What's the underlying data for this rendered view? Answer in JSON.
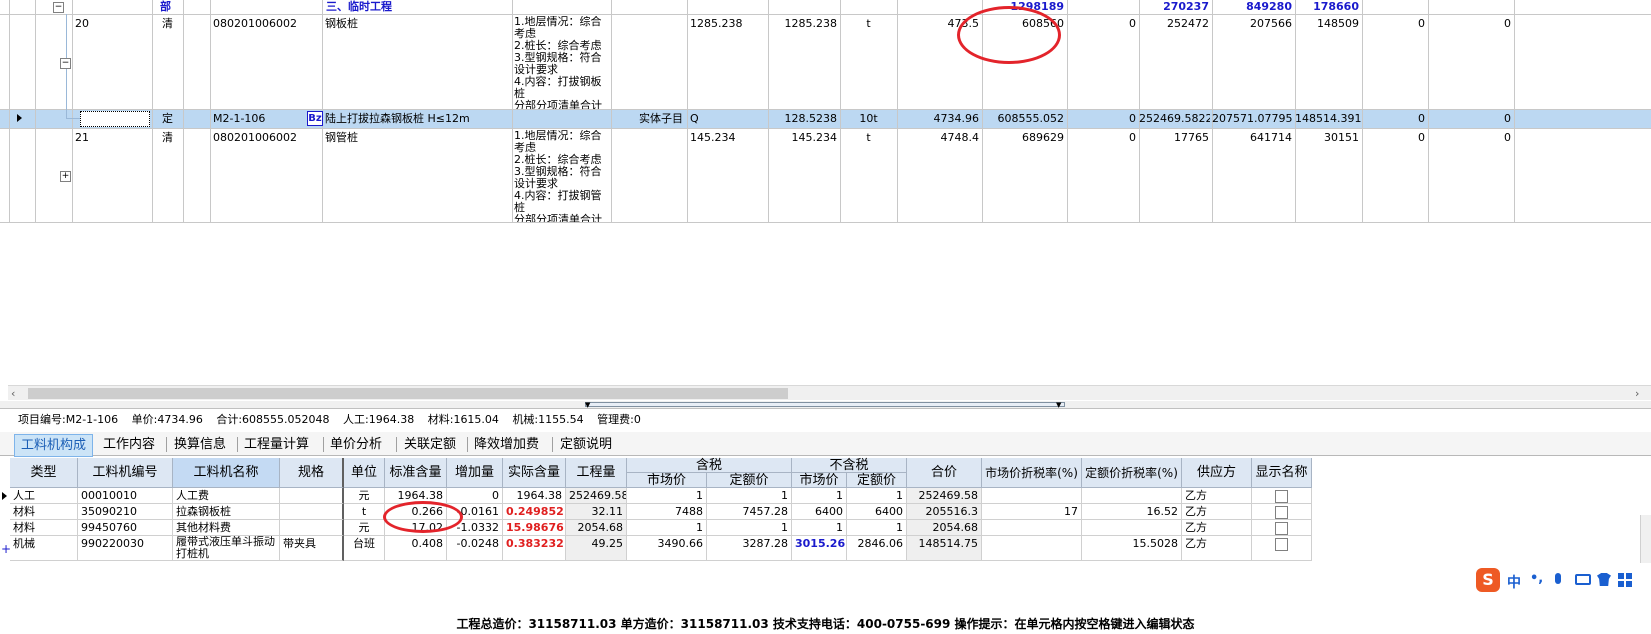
{
  "top_grid": {
    "group_row": {
      "type": "部",
      "name": "三、临时工程",
      "totals": [
        "1298189",
        "270237",
        "849280",
        "178660"
      ]
    },
    "rows": [
      {
        "seq": "20",
        "kind": "清",
        "code": "080201006002",
        "name": "钢板桩",
        "feature": "1.地层情况：综合考虑\n2.桩长：综合考虑\n3.型钢规格：符合设计要求\n4.内容：打拔钢板桩\n分部分项清单合计",
        "qty1": "1285.238",
        "qty2": "1285.238",
        "unit": "t",
        "price": "473.5",
        "c1": "608560",
        "c2": "0",
        "c3": "252472",
        "c4": "207566",
        "c5": "148509",
        "c6": "0",
        "c7": "0"
      },
      {
        "seq": "",
        "kind": "定",
        "code": "M2-1-106",
        "badge": "Bz",
        "name": "陆上打拔拉森钢板桩 H≤12m",
        "subtype": "实体子目",
        "qtyexpr": "Q",
        "qty2": "128.5238",
        "unit": "10t",
        "price": "4734.96",
        "c1": "608555.052",
        "c2": "0",
        "c3": "252469.5822",
        "c4": "207571.077952",
        "c5": "148514.3918",
        "c6": "0",
        "c7": "0"
      },
      {
        "seq": "21",
        "kind": "清",
        "code": "080201006002",
        "name": "钢管桩",
        "feature": "1.地层情况：综合考虑\n2.桩长：综合考虑\n3.型钢规格：符合设计要求\n4.内容：打拔钢管桩\n分部分项清单合计",
        "qty1": "145.234",
        "qty2": "145.234",
        "unit": "t",
        "price": "4748.4",
        "c1": "689629",
        "c2": "0",
        "c3": "17765",
        "c4": "641714",
        "c5": "30151",
        "c6": "0",
        "c7": "0"
      }
    ]
  },
  "info": {
    "code": "项目编号:M2-1-106",
    "unit_price": "单价:4734.96",
    "total": "合计:608555.052048",
    "labor": "人工:1964.38",
    "material": "材料:1615.04",
    "machine": "机械:1155.54",
    "mgmt": "管理费:0"
  },
  "tabs": [
    "工料机构成",
    "工作内容",
    "换算信息",
    "工程量计算",
    "单价分析",
    "关联定额",
    "降效增加费",
    "定额说明"
  ],
  "bottom": {
    "headers": {
      "type": "类型",
      "code": "工料机编号",
      "name": "工料机名称",
      "spec": "规格",
      "unit": "单位",
      "std": "标准含量",
      "add": "增加量",
      "actual": "实际含量",
      "qty": "工程量",
      "tax_incl": "含税",
      "tax_excl": "不含税",
      "market": "市场价",
      "quota": "定额价",
      "sum": "合价",
      "mrate": "市场价折税率(%)",
      "qrate": "定额价折税率(%)",
      "supplier": "供应方",
      "show": "显示名称"
    },
    "rows": [
      {
        "type": "人工",
        "code": "00010010",
        "name": "人工费",
        "spec": "",
        "unit": "元",
        "std": "1964.38",
        "add": "0",
        "actual": "1964.38",
        "qty": "252469.58",
        "m1": "1",
        "q1": "1",
        "m2": "1",
        "q2": "1",
        "sum": "252469.58",
        "mrate": "",
        "qrate": "",
        "supplier": "乙方"
      },
      {
        "type": "材料",
        "code": "35090210",
        "name": "拉森钢板桩",
        "spec": "",
        "unit": "t",
        "std": "0.266",
        "add": "-0.0161",
        "actual": "0.249852",
        "qty": "32.11",
        "m1": "7488",
        "q1": "7457.28",
        "m2": "6400",
        "q2": "6400",
        "sum": "205516.3",
        "mrate": "17",
        "qrate": "16.52",
        "supplier": "乙方"
      },
      {
        "type": "材料",
        "code": "99450760",
        "name": "其他材料费",
        "spec": "",
        "unit": "元",
        "std": "17.02",
        "add": "-1.0332",
        "actual": "15.98676",
        "qty": "2054.68",
        "m1": "1",
        "q1": "1",
        "m2": "1",
        "q2": "1",
        "sum": "2054.68",
        "mrate": "",
        "qrate": "",
        "supplier": "乙方"
      },
      {
        "type": "机械",
        "code": "990220030",
        "name": "履带式液压单斗振动打桩机",
        "spec": "带夹具",
        "unit": "台班",
        "std": "0.408",
        "add": "-0.0248",
        "actual": "0.383232",
        "qty": "49.25",
        "m1": "3490.66",
        "q1": "3287.28",
        "m2": "3015.26",
        "q2": "2846.06",
        "sum": "148514.75",
        "mrate": "",
        "qrate": "15.5028",
        "supplier": "乙方"
      }
    ]
  },
  "status": "工程总造价：31158711.03  单方造价：31158711.03  技术支持电话：400-0755-699  操作提示：在单元格内按空格键进入编辑状态",
  "ime": {
    "zh": "中",
    "punct": "•,"
  },
  "colors": {
    "selected_row": "#bcd8f2",
    "header_bg": "#dde7f3",
    "accent_blue": "#1a1acc",
    "red": "#e02020",
    "annotation": "#e3242b"
  }
}
